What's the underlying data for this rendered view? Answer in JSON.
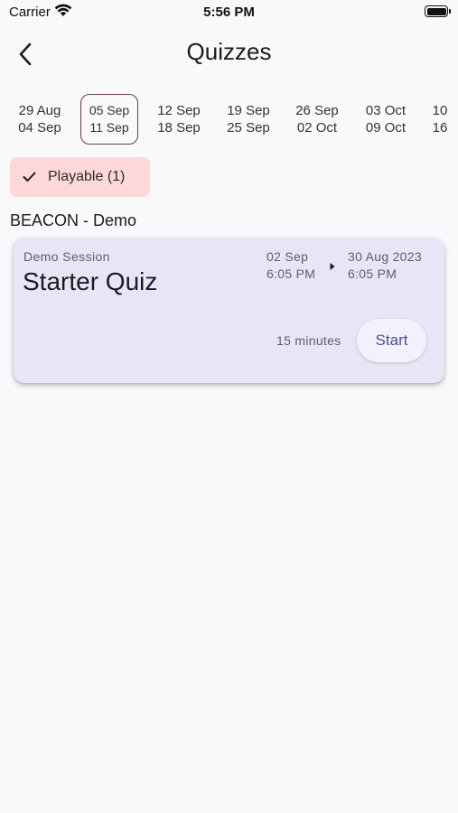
{
  "status_bar": {
    "carrier": "Carrier",
    "time": "5:56 PM"
  },
  "app_bar": {
    "title": "Quizzes",
    "back_icon": "chevron-left-icon"
  },
  "weeks": [
    {
      "start": "29 Aug",
      "end": "04 Sep",
      "selected": false
    },
    {
      "start": "05 Sep",
      "end": "11 Sep",
      "selected": true
    },
    {
      "start": "12 Sep",
      "end": "18 Sep",
      "selected": false
    },
    {
      "start": "19 Sep",
      "end": "25 Sep",
      "selected": false
    },
    {
      "start": "26 Sep",
      "end": "02 Oct",
      "selected": false
    },
    {
      "start": "03 Oct",
      "end": "09 Oct",
      "selected": false
    },
    {
      "start": "10",
      "end": "16",
      "selected": false
    }
  ],
  "filter_chip": {
    "label": "Playable (1)",
    "icon": "check-icon",
    "background": "#fdd8d9"
  },
  "group": {
    "title": "BEACON - Demo"
  },
  "quiz_card": {
    "session": "Demo Session",
    "title": "Starter Quiz",
    "start_date": "02 Sep",
    "start_time": "6:05 PM",
    "end_date": "30 Aug 2023",
    "end_time": "6:05 PM",
    "duration": "15 minutes",
    "start_label": "Start",
    "background": "#e7e6f6"
  },
  "colors": {
    "accent": "#47509a",
    "selected_outline": "#6d3c42"
  }
}
